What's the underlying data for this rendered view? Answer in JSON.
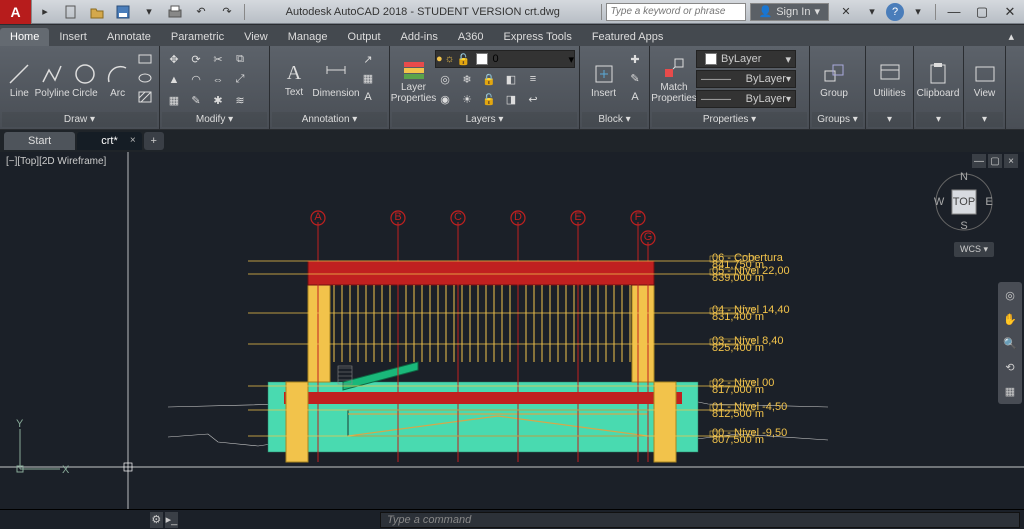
{
  "title": "Autodesk AutoCAD 2018 - STUDENT VERSION   crt.dwg",
  "search_placeholder": "Type a keyword or phrase",
  "signin": "Sign In",
  "tabs": [
    "Home",
    "Insert",
    "Annotate",
    "Parametric",
    "View",
    "Manage",
    "Output",
    "Add-ins",
    "A360",
    "Express Tools",
    "Featured Apps"
  ],
  "active_tab": 0,
  "ribbon": {
    "draw": {
      "label": "Draw ▾",
      "line": "Line",
      "polyline": "Polyline",
      "circle": "Circle",
      "arc": "Arc"
    },
    "modify": {
      "label": "Modify ▾"
    },
    "annotation": {
      "label": "Annotation ▾",
      "text": "Text",
      "dimension": "Dimension"
    },
    "layers": {
      "label": "Layers ▾",
      "properties": "Layer\nProperties",
      "current": "0"
    },
    "block": {
      "label": "Block ▾",
      "insert": "Insert"
    },
    "properties": {
      "label": "Properties ▾",
      "match": "Match\nProperties",
      "bylayer": "ByLayer"
    },
    "groups": {
      "label": "Groups ▾",
      "group": "Group"
    },
    "util": {
      "label": "▾",
      "utilities": "Utilities"
    },
    "clip": {
      "label": "▾",
      "clipboard": "Clipboard"
    },
    "view": {
      "label": "▾",
      "view": "View"
    }
  },
  "doc_tabs": {
    "start": "Start",
    "file": "crt*"
  },
  "viewport_label": "[−][Top][2D Wireframe]",
  "viewcube": {
    "top": "TOP",
    "n": "N",
    "s": "S",
    "e": "E",
    "w": "W",
    "wcs": "WCS ▾"
  },
  "command_placeholder": "Type a command",
  "levels": [
    {
      "name": "06 - Cobertura",
      "elev": "841,750 m"
    },
    {
      "name": "05 - Nível 22,00",
      "elev": "839,000 m"
    },
    {
      "name": "04 - Nível 14,40",
      "elev": "831,400 m"
    },
    {
      "name": "03 - Nível 8,40",
      "elev": "825,400 m"
    },
    {
      "name": "02 - Nível 00",
      "elev": "817,000 m"
    },
    {
      "name": "01 - Nível -4,50",
      "elev": "812,500 m"
    },
    {
      "name": "00 - Nível -9,50",
      "elev": "807,500 m"
    }
  ]
}
